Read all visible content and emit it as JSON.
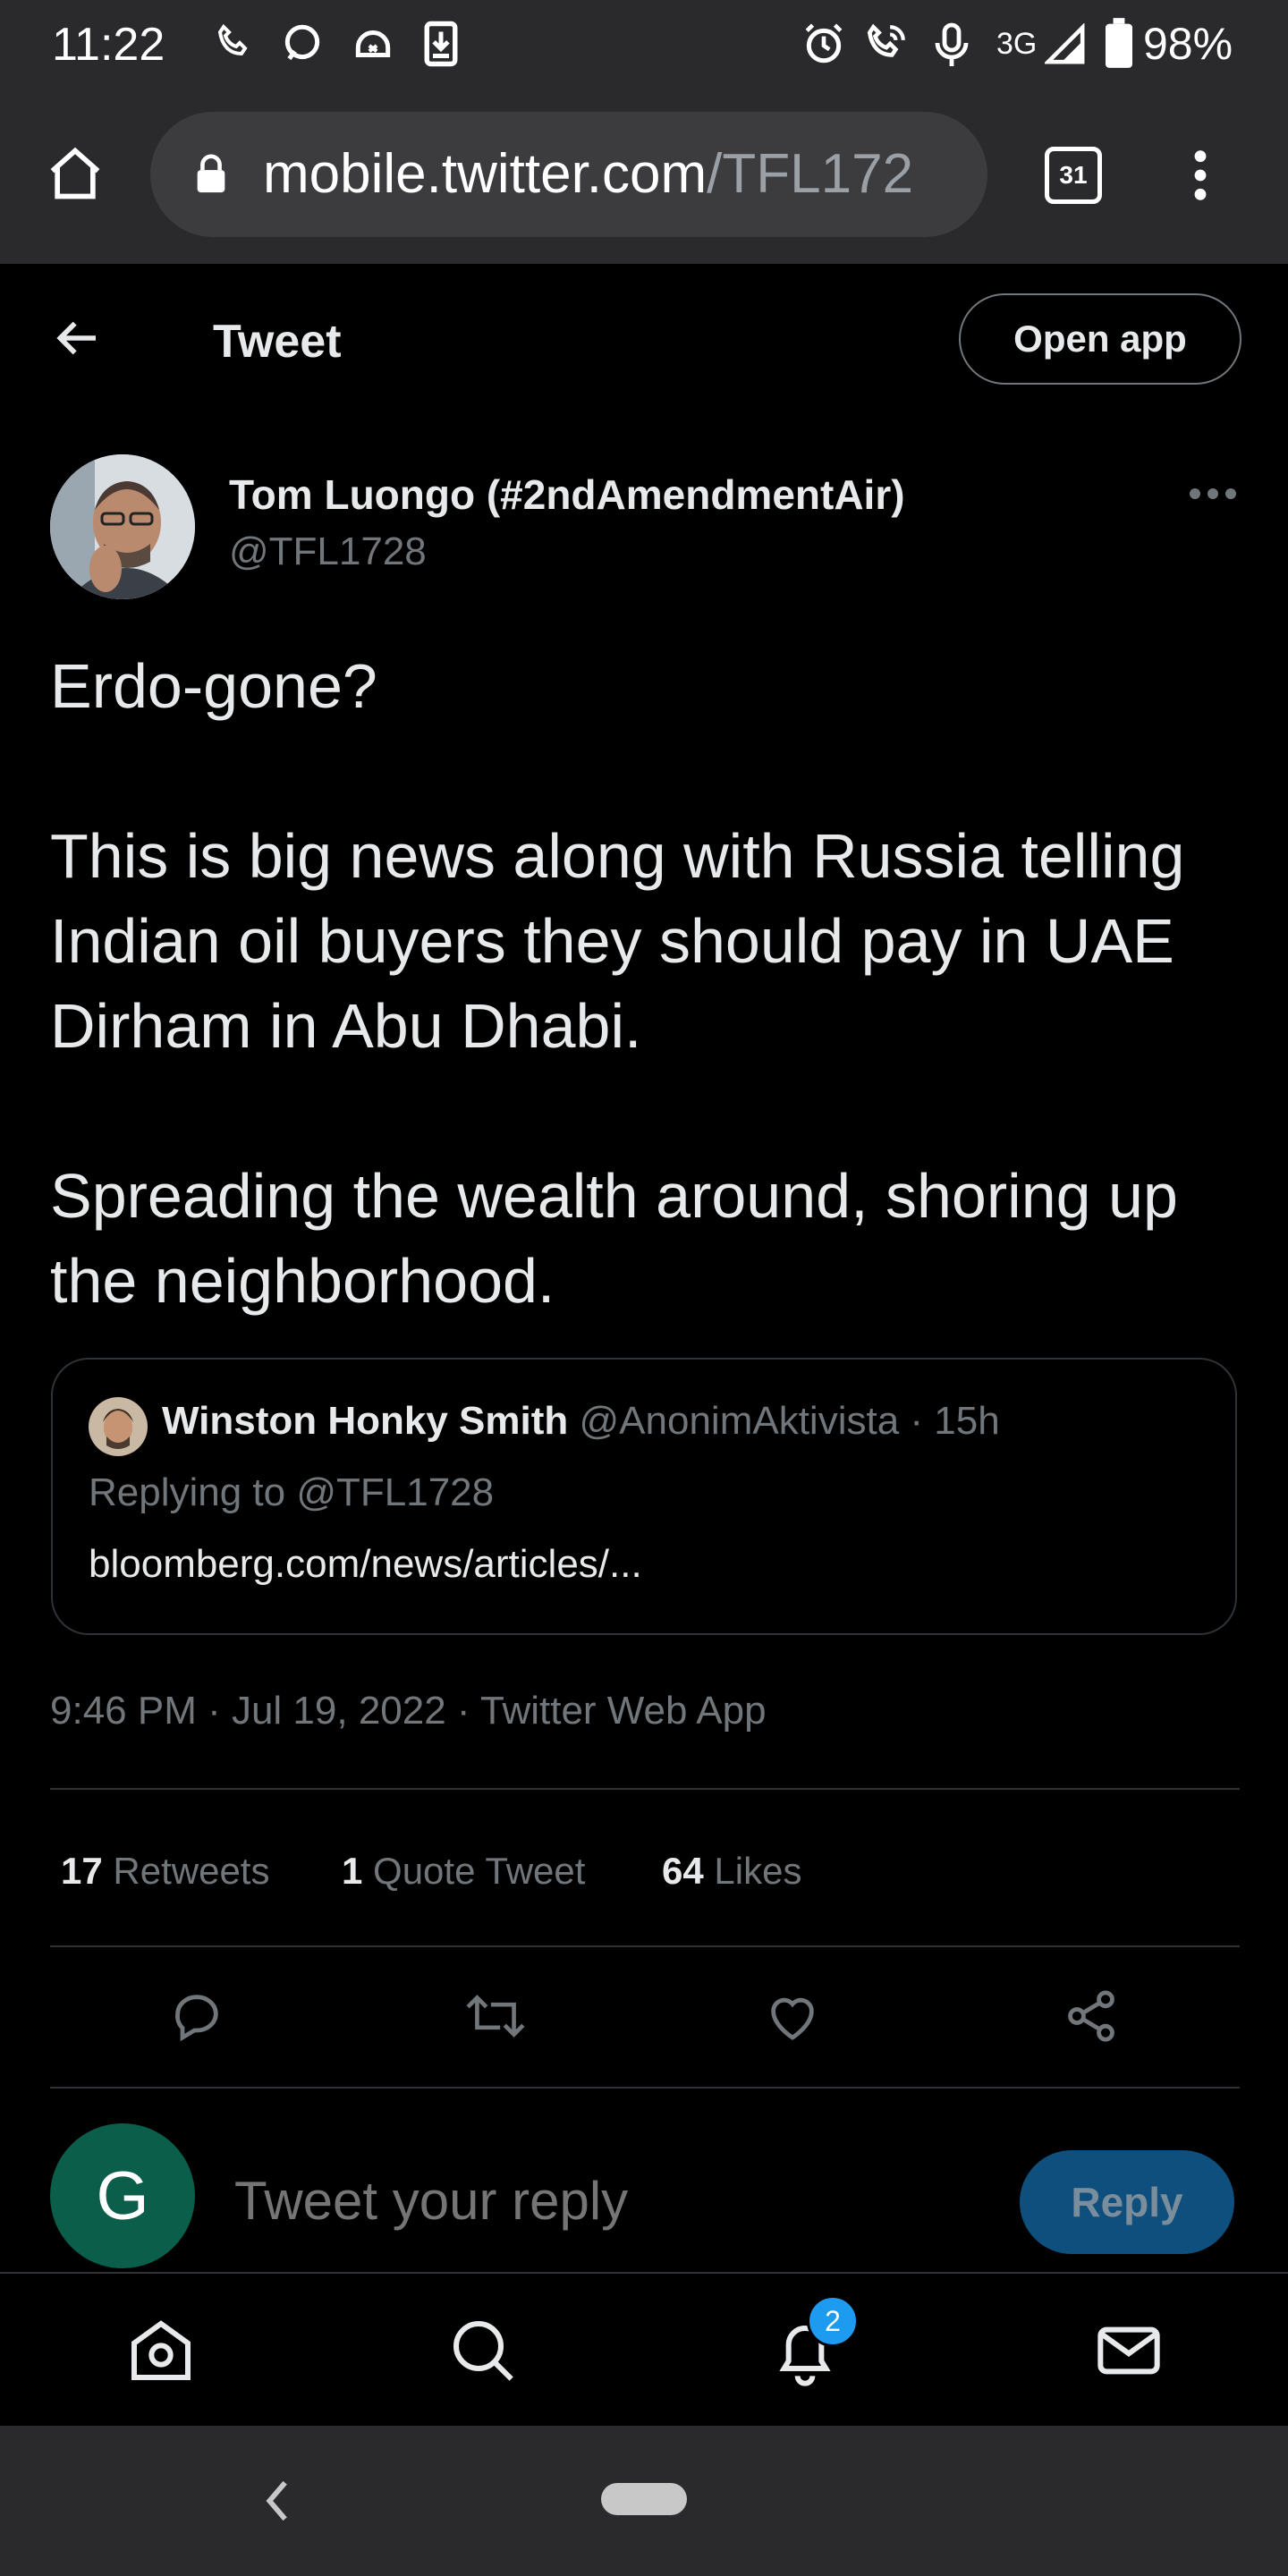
{
  "status_bar": {
    "time": "11:22",
    "network": "3G",
    "battery": "98%",
    "icons": [
      "phone-icon",
      "chat-bubble-icon",
      "sync-icon",
      "download-icon",
      "alarm-icon",
      "wifi-calling-icon",
      "mic-icon",
      "signal-icon",
      "battery-icon"
    ]
  },
  "browser": {
    "url_host": "mobile.twitter.com",
    "url_path": "/TFL172",
    "tab_count": "31"
  },
  "header": {
    "title": "Tweet",
    "open_app": "Open app"
  },
  "tweet": {
    "author_name": "Tom Luongo (#2ndAmendmentAir)",
    "author_handle": "@TFL1728",
    "paragraphs": [
      "Erdo-gone?",
      "This is big news along with Russia telling Indian oil buyers they should pay in UAE Dirham in Abu Dhabi.",
      "Spreading the wealth around, shoring up the neighborhood."
    ],
    "timestamp": "9:46 PM · Jul 19, 2022 · Twitter Web App"
  },
  "quote": {
    "name": "Winston Honky Smith",
    "handle": "@AnonimAktivista",
    "age": "· 15h",
    "replying": "Replying to @TFL1728",
    "link": "bloomberg.com/news/articles/..."
  },
  "stats": {
    "retweets_num": "17",
    "retweets_lbl": "Retweets",
    "quotes_num": "1",
    "quotes_lbl": "Quote Tweet",
    "likes_num": "64",
    "likes_lbl": "Likes"
  },
  "reply_box": {
    "avatar_letter": "G",
    "placeholder": "Tweet your reply",
    "button": "Reply"
  },
  "bottom_nav": {
    "notification_count": "2"
  },
  "colors": {
    "accent": "#1d9bf0",
    "muted": "#71767b",
    "avatar_bg": "#0b5e4a"
  }
}
